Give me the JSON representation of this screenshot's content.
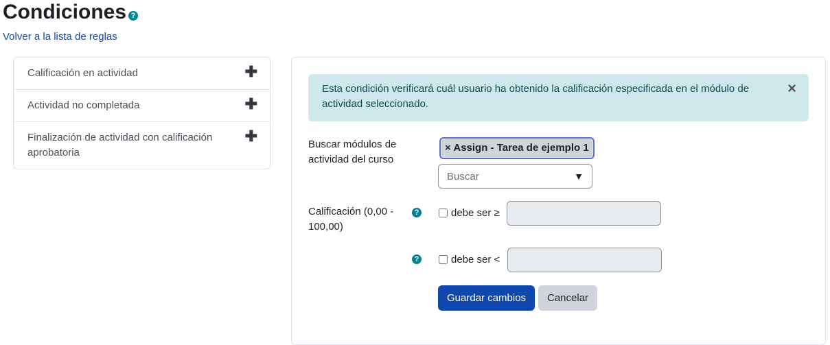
{
  "page": {
    "title": "Condiciones",
    "back_link": "Volver a la lista de reglas"
  },
  "conditions_list": [
    {
      "label": "Calificación en actividad"
    },
    {
      "label": "Actividad no completada"
    },
    {
      "label": "Finalización de actividad con calificación aprobatoria"
    }
  ],
  "alert": {
    "text": "Esta condición verificará cuál usuario ha obtenido la calificación especificada en el módulo de actividad seleccionado.",
    "close": "×"
  },
  "form": {
    "modules_label": "Buscar módulos de actividad del curso",
    "selected_module": "× Assign - Tarea de ejemplo 1",
    "search_placeholder": "Buscar",
    "dropdown_arrow": "▼",
    "grade_label": "Calificación (0,00 - 100,00)",
    "min_check_label": "debe ser ≥",
    "max_check_label": "debe ser <",
    "min_value": "",
    "max_value": "",
    "save_button": "Guardar cambios",
    "cancel_button": "Cancelar"
  },
  "icons": {
    "help": "?",
    "plus": "✚"
  }
}
